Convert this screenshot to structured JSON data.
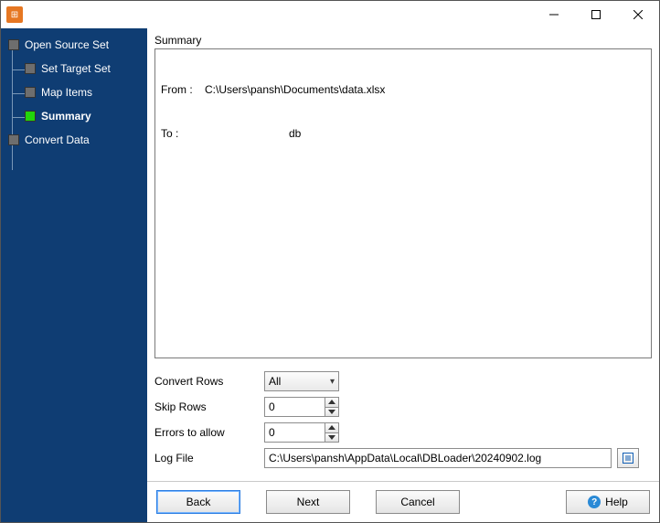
{
  "window": {
    "title": ""
  },
  "sidebar": {
    "items": [
      {
        "label": "Open Source Set"
      },
      {
        "label": "Set Target Set"
      },
      {
        "label": "Map Items"
      },
      {
        "label": "Summary"
      },
      {
        "label": "Convert Data"
      }
    ]
  },
  "summary": {
    "heading": "Summary",
    "from_label": "From :",
    "from_value": "C:\\Users\\pansh\\Documents\\data.xlsx",
    "to_label": "To :",
    "to_value": "db"
  },
  "options": {
    "convert_rows": {
      "label": "Convert Rows",
      "value": "All"
    },
    "skip_rows": {
      "label": "Skip Rows",
      "value": "0"
    },
    "errors": {
      "label": "Errors to allow",
      "value": "0"
    },
    "log_file": {
      "label": "Log File",
      "value": "C:\\Users\\pansh\\AppData\\Local\\DBLoader\\20240902.log"
    }
  },
  "buttons": {
    "back": "Back",
    "next": "Next",
    "cancel": "Cancel",
    "help": "Help"
  }
}
